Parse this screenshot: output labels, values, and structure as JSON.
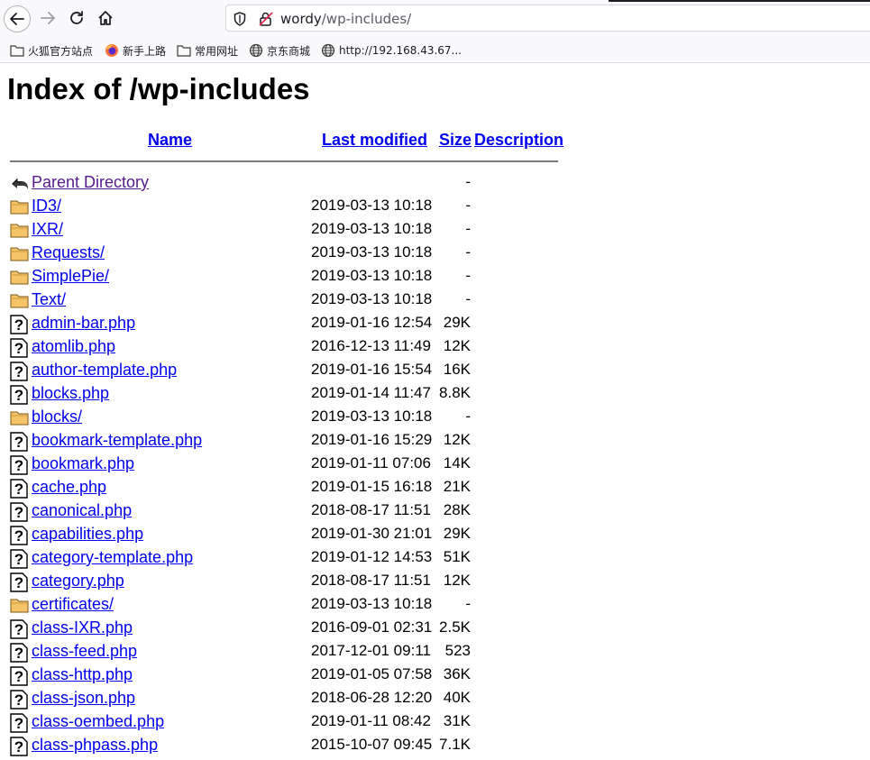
{
  "browser": {
    "url_host": "wordy",
    "url_path": "/wp-includes/",
    "bookmarks": [
      {
        "label": "火狐官方站点",
        "icon": "folder-icon"
      },
      {
        "label": "新手上路",
        "icon": "firefox-icon"
      },
      {
        "label": "常用网址",
        "icon": "folder-icon"
      },
      {
        "label": "京东商城",
        "icon": "globe-icon"
      },
      {
        "label": "http://192.168.43.67...",
        "icon": "globe-icon"
      }
    ]
  },
  "page": {
    "title": "Index of /wp-includes",
    "columns": {
      "name": "Name",
      "modified": "Last modified",
      "size": "Size",
      "description": "Description"
    },
    "rows": [
      {
        "icon": "back",
        "name": "Parent Directory",
        "modified": "",
        "size": "-"
      },
      {
        "icon": "folder",
        "name": "ID3/",
        "modified": "2019-03-13 10:18",
        "size": "-"
      },
      {
        "icon": "folder",
        "name": "IXR/",
        "modified": "2019-03-13 10:18",
        "size": "-"
      },
      {
        "icon": "folder",
        "name": "Requests/",
        "modified": "2019-03-13 10:18",
        "size": "-"
      },
      {
        "icon": "folder",
        "name": "SimplePie/",
        "modified": "2019-03-13 10:18",
        "size": "-"
      },
      {
        "icon": "folder",
        "name": "Text/",
        "modified": "2019-03-13 10:18",
        "size": "-"
      },
      {
        "icon": "file",
        "name": "admin-bar.php",
        "modified": "2019-01-16 12:54",
        "size": "29K"
      },
      {
        "icon": "file",
        "name": "atomlib.php",
        "modified": "2016-12-13 11:49",
        "size": "12K"
      },
      {
        "icon": "file",
        "name": "author-template.php",
        "modified": "2019-01-16 15:54",
        "size": "16K"
      },
      {
        "icon": "file",
        "name": "blocks.php",
        "modified": "2019-01-14 11:47",
        "size": "8.8K"
      },
      {
        "icon": "folder",
        "name": "blocks/",
        "modified": "2019-03-13 10:18",
        "size": "-"
      },
      {
        "icon": "file",
        "name": "bookmark-template.php",
        "modified": "2019-01-16 15:29",
        "size": "12K"
      },
      {
        "icon": "file",
        "name": "bookmark.php",
        "modified": "2019-01-11 07:06",
        "size": "14K"
      },
      {
        "icon": "file",
        "name": "cache.php",
        "modified": "2019-01-15 16:18",
        "size": "21K"
      },
      {
        "icon": "file",
        "name": "canonical.php",
        "modified": "2018-08-17 11:51",
        "size": "28K"
      },
      {
        "icon": "file",
        "name": "capabilities.php",
        "modified": "2019-01-30 21:01",
        "size": "29K"
      },
      {
        "icon": "file",
        "name": "category-template.php",
        "modified": "2019-01-12 14:53",
        "size": "51K"
      },
      {
        "icon": "file",
        "name": "category.php",
        "modified": "2018-08-17 11:51",
        "size": "12K"
      },
      {
        "icon": "folder",
        "name": "certificates/",
        "modified": "2019-03-13 10:18",
        "size": "-"
      },
      {
        "icon": "file",
        "name": "class-IXR.php",
        "modified": "2016-09-01 02:31",
        "size": "2.5K"
      },
      {
        "icon": "file",
        "name": "class-feed.php",
        "modified": "2017-12-01 09:11",
        "size": "523"
      },
      {
        "icon": "file",
        "name": "class-http.php",
        "modified": "2019-01-05 07:58",
        "size": "36K"
      },
      {
        "icon": "file",
        "name": "class-json.php",
        "modified": "2018-06-28 12:20",
        "size": "40K"
      },
      {
        "icon": "file",
        "name": "class-oembed.php",
        "modified": "2019-01-11 08:42",
        "size": "31K"
      },
      {
        "icon": "file",
        "name": "class-phpass.php",
        "modified": "2015-10-07 09:45",
        "size": "7.1K"
      }
    ]
  }
}
